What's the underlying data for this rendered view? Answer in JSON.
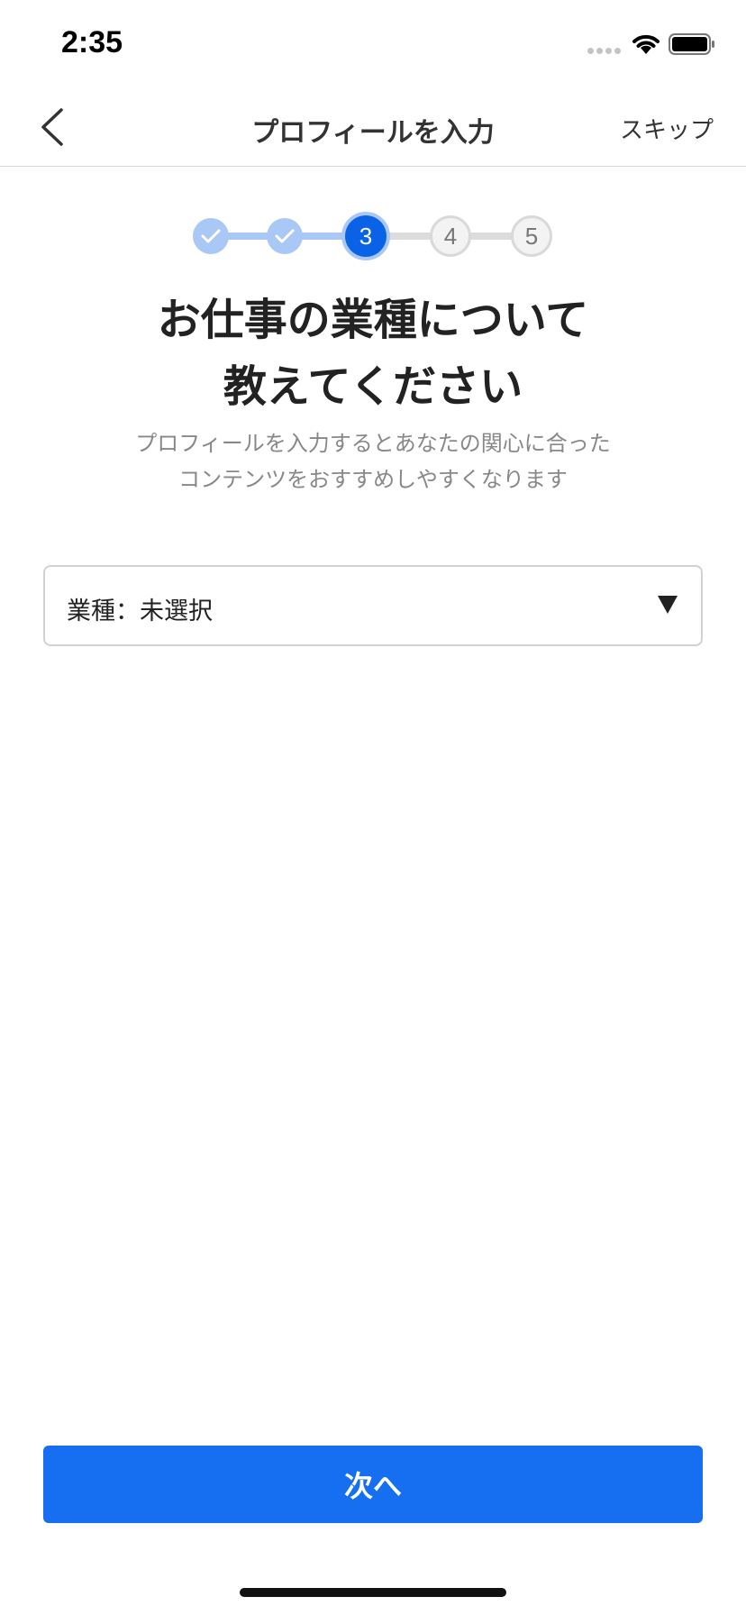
{
  "status_bar": {
    "time": "2:35",
    "icons": [
      "signal-dots-icon",
      "wifi-icon",
      "battery-icon"
    ]
  },
  "nav": {
    "back_icon": "chevron-left-icon",
    "title": "プロフィールを入力",
    "skip_label": "スキップ"
  },
  "stepper": {
    "current_step": 3,
    "steps": [
      {
        "label": "",
        "state": "done",
        "icon": "check-icon"
      },
      {
        "label": "",
        "state": "done",
        "icon": "check-icon"
      },
      {
        "label": "3",
        "state": "current"
      },
      {
        "label": "4",
        "state": "todo"
      },
      {
        "label": "5",
        "state": "todo"
      }
    ]
  },
  "heading": {
    "line1": "お仕事の業種について",
    "line2": "教えてください"
  },
  "subtext": {
    "line1": "プロフィールを入力するとあなたの関心に合った",
    "line2": "コンテンツをおすすめしやすくなります"
  },
  "industry_select": {
    "value": "業種：未選択",
    "icon": "triangle-down-icon"
  },
  "footer": {
    "next_label": "次へ"
  },
  "colors": {
    "accent": "#166ff0",
    "step_current": "#0a63e6",
    "step_done": "#a9c8f5",
    "subtext": "#888888"
  }
}
